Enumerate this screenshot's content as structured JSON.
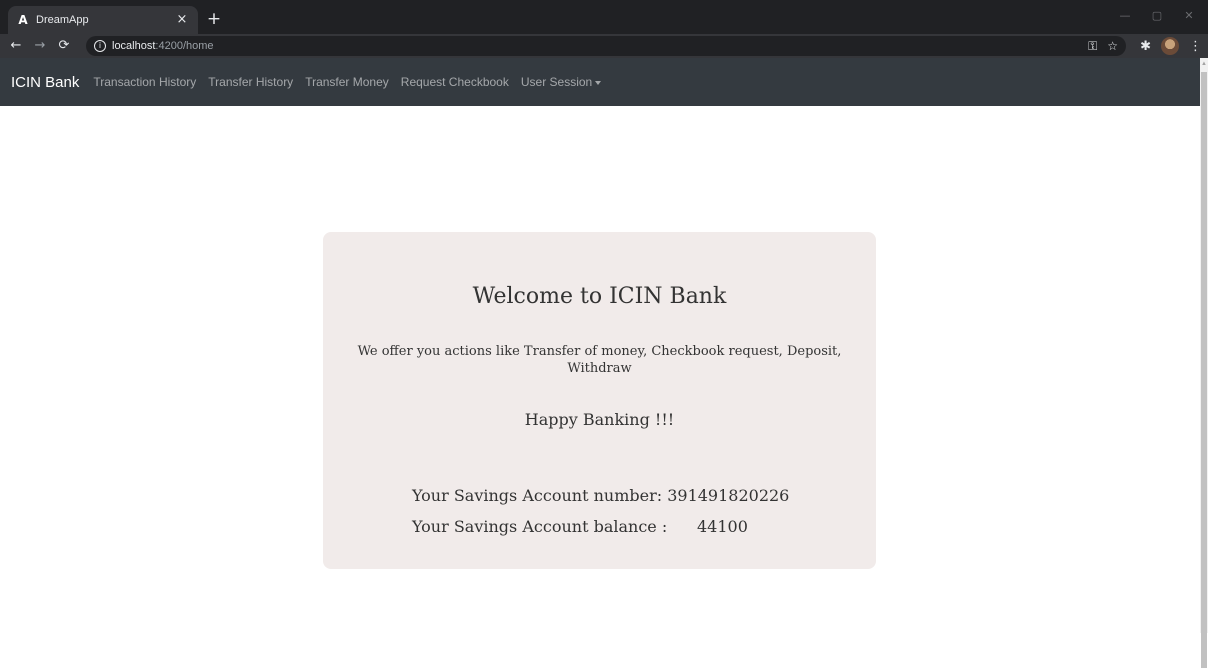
{
  "browser": {
    "tab_title": "DreamApp",
    "tab_favicon": "A",
    "tab_close": "×",
    "new_tab": "+",
    "url_host": "localhost",
    "url_path": ":4200/home"
  },
  "navbar": {
    "brand": "ICIN Bank",
    "links": [
      "Transaction History",
      "Transfer History",
      "Transfer Money",
      "Request Checkbook",
      "User Session"
    ]
  },
  "card": {
    "title": "Welcome to ICIN Bank",
    "description": "We offer you actions like Transfer of money, Checkbook request, Deposit, Withdraw",
    "greeting": "Happy Banking !!!",
    "account_number_label": "Your Savings Account number: ",
    "account_number": "391491820226",
    "balance_label": "Your Savings Account balance :",
    "balance": "44100"
  },
  "colors": {
    "navbar_bg": "#343a40",
    "card_bg": "#f1ebea"
  }
}
